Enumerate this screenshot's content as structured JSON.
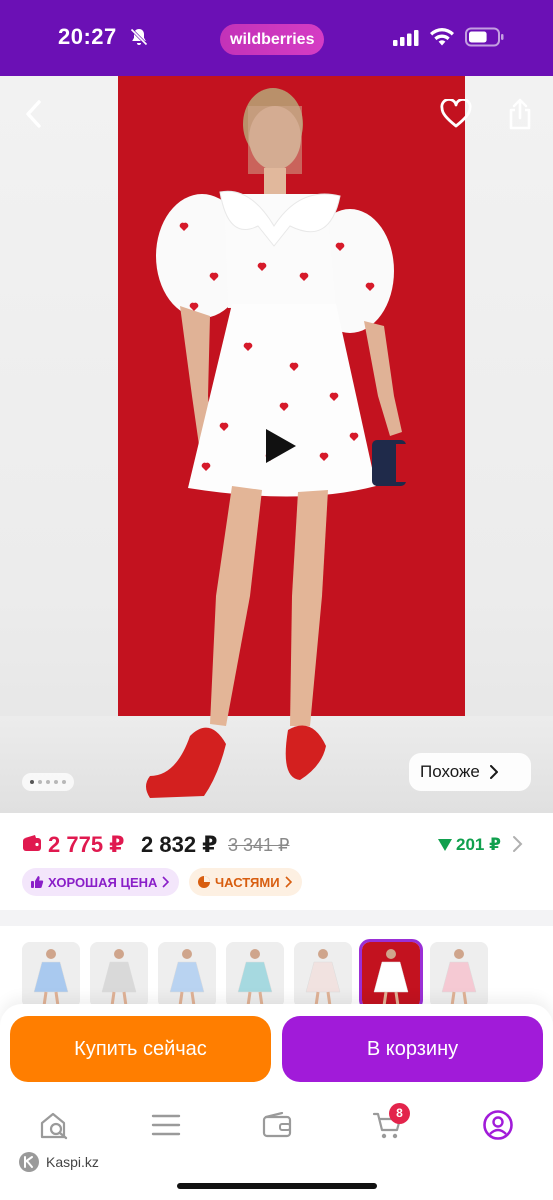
{
  "status_bar": {
    "time": "20:27",
    "brand": "wildberries",
    "bell_icon": "bell-slash-icon",
    "signal_icon": "cellular-signal-icon",
    "wifi_icon": "wifi-icon",
    "battery_icon": "battery-icon",
    "battery_level": 0.65
  },
  "gallery": {
    "back_icon": "chevron-left-icon",
    "favorite_icon": "heart-outline-icon",
    "share_icon": "share-icon",
    "play_icon": "play-icon",
    "page_count": 5,
    "current_page": 1,
    "similar_label": "Похоже"
  },
  "price": {
    "wallet_price": "2 775 ₽",
    "price": "2 832 ₽",
    "old_price": "3 341 ₽",
    "discount": "201 ₽",
    "badges": [
      {
        "label": "ХОРОШАЯ ЦЕНА",
        "icon": "thumbs-up-icon"
      },
      {
        "label": "ЧАСТЯМИ",
        "icon": "pie-chart-icon"
      }
    ]
  },
  "colors": {
    "brand_purple": "#6b10b5",
    "buy_orange": "#ff7e00",
    "cart_purple": "#a11bd9",
    "price_red": "#e0194f",
    "discount_green": "#11a04e"
  },
  "variants": {
    "count": 7,
    "selected_index": 5,
    "colors": [
      "#a9c9ef",
      "#d9d9d9",
      "#b9d3f1",
      "#a6d9e0",
      "#f1e2e0",
      "#ffffff",
      "#f5c9d3"
    ]
  },
  "actions": {
    "buy_now": "Купить сейчас",
    "add_to_cart": "В корзину"
  },
  "tabbar": {
    "items": [
      {
        "name": "home",
        "icon": "search-home-icon"
      },
      {
        "name": "catalog",
        "icon": "menu-icon"
      },
      {
        "name": "wallet",
        "icon": "wallet-icon"
      },
      {
        "name": "cart",
        "icon": "cart-icon"
      },
      {
        "name": "profile",
        "icon": "profile-icon"
      }
    ],
    "cart_count": "8"
  },
  "watermark": "Kaspi.kz"
}
